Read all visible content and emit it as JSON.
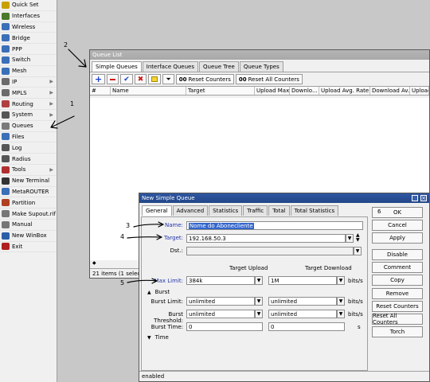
{
  "sidebar": {
    "items": [
      {
        "label": "Quick Set",
        "icon": "quickset-icon",
        "sub": false
      },
      {
        "label": "Interfaces",
        "icon": "interfaces-icon",
        "sub": false
      },
      {
        "label": "Wireless",
        "icon": "wireless-icon",
        "sub": false
      },
      {
        "label": "Bridge",
        "icon": "bridge-icon",
        "sub": false
      },
      {
        "label": "PPP",
        "icon": "ppp-icon",
        "sub": false
      },
      {
        "label": "Switch",
        "icon": "switch-icon",
        "sub": false
      },
      {
        "label": "Mesh",
        "icon": "mesh-icon",
        "sub": false
      },
      {
        "label": "IP",
        "icon": "ip-icon",
        "sub": true
      },
      {
        "label": "MPLS",
        "icon": "mpls-icon",
        "sub": true
      },
      {
        "label": "Routing",
        "icon": "routing-icon",
        "sub": true
      },
      {
        "label": "System",
        "icon": "system-icon",
        "sub": true
      },
      {
        "label": "Queues",
        "icon": "queues-icon",
        "sub": false
      },
      {
        "label": "Files",
        "icon": "files-icon",
        "sub": false
      },
      {
        "label": "Log",
        "icon": "log-icon",
        "sub": false
      },
      {
        "label": "Radius",
        "icon": "radius-icon",
        "sub": false
      },
      {
        "label": "Tools",
        "icon": "tools-icon",
        "sub": true
      },
      {
        "label": "New Terminal",
        "icon": "terminal-icon",
        "sub": false
      },
      {
        "label": "MetaROUTER",
        "icon": "metarouter-icon",
        "sub": false
      },
      {
        "label": "Partition",
        "icon": "partition-icon",
        "sub": false
      },
      {
        "label": "Make Supout.rif",
        "icon": "supout-icon",
        "sub": false
      },
      {
        "label": "Manual",
        "icon": "manual-icon",
        "sub": false
      },
      {
        "label": "New WinBox",
        "icon": "winbox-icon",
        "sub": false
      },
      {
        "label": "Exit",
        "icon": "exit-icon",
        "sub": false
      }
    ]
  },
  "queue_list": {
    "title": "Queue List",
    "tabs": [
      "Simple Queues",
      "Interface Queues",
      "Queue Tree",
      "Queue Types"
    ],
    "reset_counters": "Reset Counters",
    "reset_all_counters": "Reset All Counters",
    "columns": [
      "#",
      "Name",
      "Target",
      "Upload Max...",
      "Downlo...",
      "Upload Avg. Rate",
      "Download Av...",
      "Upload Qu"
    ],
    "status": "21 items (1 selected)"
  },
  "new_queue": {
    "title": "New Simple Queue",
    "tabs": [
      "General",
      "Advanced",
      "Statistics",
      "Traffic",
      "Total",
      "Total Statistics"
    ],
    "name_label": "Name:",
    "name_value": "Nome do Abonecliente",
    "target_label": "Target:",
    "target_value": "192.168.50.3",
    "dst_label": "Dst.:",
    "target_upload_header": "Target Upload",
    "target_download_header": "Target Download",
    "max_limit_label": "Max Limit:",
    "max_limit_upload": "384k",
    "max_limit_download": "1M",
    "unit": "bits/s",
    "burst_section": "Burst",
    "burst_limit_label": "Burst Limit:",
    "burst_limit_upload": "unlimited",
    "burst_limit_download": "unlimited",
    "burst_threshold_label": "Burst Threshold:",
    "burst_threshold_upload": "unlimited",
    "burst_threshold_download": "unlimited",
    "burst_time_label": "Burst Time:",
    "burst_time_upload": "0",
    "burst_time_download": "0",
    "burst_time_unit": "s",
    "time_section": "Time",
    "status": "enabled",
    "buttons": [
      "OK",
      "Cancel",
      "Apply",
      "Disable",
      "Comment",
      "Copy",
      "Remove",
      "Reset Counters",
      "Reset All Counters",
      "Torch"
    ]
  },
  "annotations": {
    "n1": "1",
    "n2": "2",
    "n3": "3",
    "n4": "4",
    "n5": "5",
    "n6": "6"
  }
}
